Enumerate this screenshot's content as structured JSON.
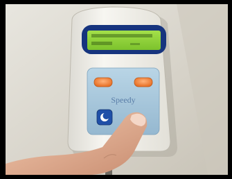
{
  "device": {
    "brand_label": "Speedy",
    "screen_text_line1": "",
    "screen_text_line2": ""
  },
  "colors": {
    "frame": "#000000",
    "wall": "#d9d5cc",
    "device_body": "#f2f0ea",
    "lcd": "#8fd43a",
    "lcd_bezel": "#16347e",
    "keypad": "#a9c9de",
    "soft_button": "#f08a3c",
    "blue_button": "#1f4fa8",
    "skin": "#e6b59a"
  },
  "icons": {
    "left_button_icon": "moon-icon"
  }
}
